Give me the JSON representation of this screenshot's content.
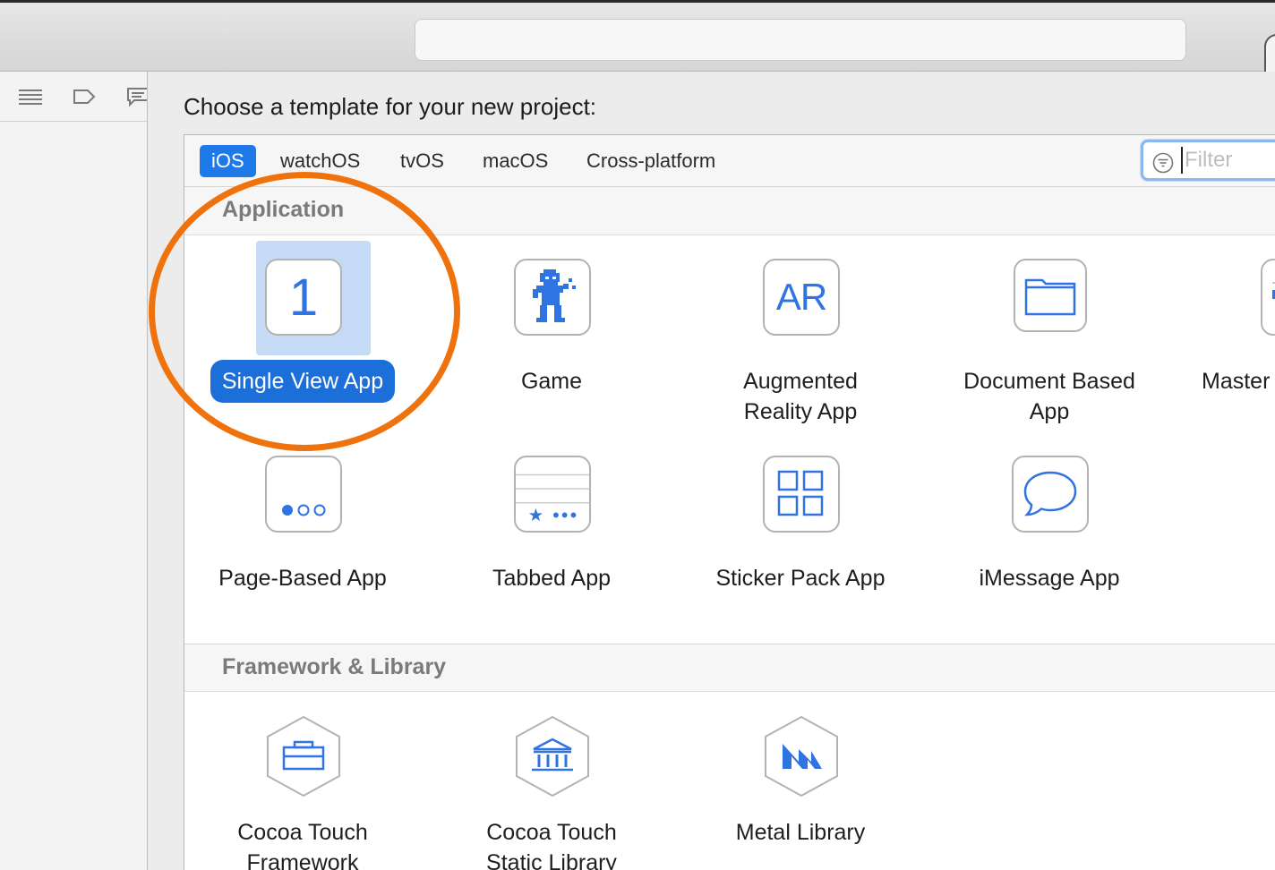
{
  "sheet": {
    "prompt": "Choose a template for your new project:"
  },
  "platform_tabs": [
    {
      "label": "iOS",
      "active": true
    },
    {
      "label": "watchOS",
      "active": false
    },
    {
      "label": "tvOS",
      "active": false
    },
    {
      "label": "macOS",
      "active": false
    },
    {
      "label": "Cross-platform",
      "active": false
    }
  ],
  "filter": {
    "placeholder": "Filter"
  },
  "sections": {
    "application": {
      "title": "Application",
      "templates": [
        {
          "label": "Single View App",
          "icon": "single-view-icon",
          "icon_text": "1",
          "selected": true
        },
        {
          "label": "Game",
          "icon": "game-icon"
        },
        {
          "label": "Augmented Reality App",
          "icon": "ar-icon",
          "icon_text": "AR"
        },
        {
          "label": "Document Based App",
          "icon": "folder-icon"
        },
        {
          "label": "Master",
          "icon": "master-detail-icon"
        },
        {
          "label": "Page-Based App",
          "icon": "page-dots-icon"
        },
        {
          "label": "Tabbed App",
          "icon": "tab-bar-icon"
        },
        {
          "label": "Sticker Pack App",
          "icon": "grid-icon"
        },
        {
          "label": "iMessage App",
          "icon": "message-bubble-icon"
        }
      ]
    },
    "framework": {
      "title": "Framework & Library",
      "templates": [
        {
          "label": "Cocoa Touch Framework",
          "icon": "toolbox-hex-icon"
        },
        {
          "label": "Cocoa Touch Static Library",
          "icon": "library-hex-icon"
        },
        {
          "label": "Metal Library",
          "icon": "metal-hex-icon"
        }
      ]
    }
  },
  "colors": {
    "accent": "#1e7ae8",
    "selection": "#c5daf4",
    "highlight_ring": "#f0720d",
    "icon_blue": "#2f74e0"
  }
}
